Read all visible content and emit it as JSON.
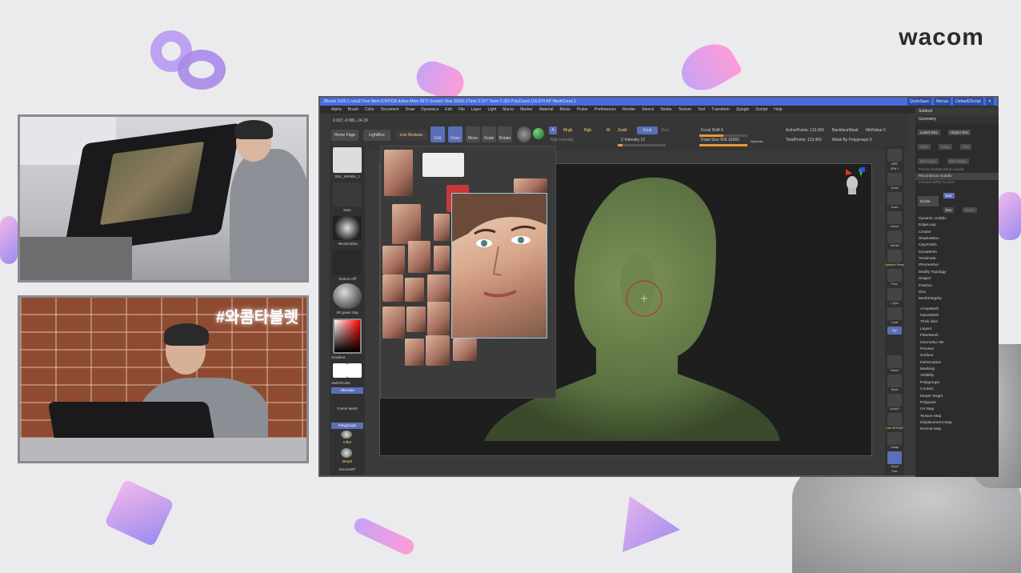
{
  "brand": {
    "logo": "wacom"
  },
  "camera": {
    "neon_sign": "#와콤타블렛"
  },
  "zbrush": {
    "titlebar": "ZBrush 2020.1   cara2   Free Mem 8.947GB  Active Mem 2872  Scratch Disk 20690  ZTime 2.037  Timer 0.301  PolyCount 116.074 KP  MeshCount 1",
    "titlebar_right": [
      "QuickSave",
      "Menus",
      "DefaultZScript"
    ],
    "menus": [
      "Alpha",
      "Brush",
      "Color",
      "Document",
      "Draw",
      "Dynamics",
      "Edit",
      "File",
      "Layer",
      "Light",
      "Macro",
      "Marker",
      "Material",
      "Movie",
      "Picker",
      "Preferences",
      "Render",
      "Stencil",
      "Stroke",
      "Texture",
      "Tool",
      "Transform",
      "Zplugin",
      "Zscript",
      "Help"
    ],
    "coords": "2.007,-0.081,-14.29",
    "toolbar": {
      "home_page": "Home Page",
      "lightbox": "LightBox",
      "live_boolean": "Live Boolean",
      "edit": "Edit",
      "draw": "Draw",
      "move": "Move",
      "scale": "Scale",
      "rotate": "Rotate",
      "a": "A",
      "mrgb": "Mrgb",
      "rgb": "Rgb",
      "m": "M",
      "zadd": "Zadd",
      "zsub": "Zsub",
      "zcut": "Zcut",
      "rgb_intensity": "Rgb Intensity",
      "z_intensity": "Z Intensity 12",
      "focal_shift": "Focal Shift 0",
      "draw_size": "Draw Size 905.16583",
      "dynamic": "Dynamic",
      "active_points": "ActivePoints: 113,455",
      "total_points": "TotalPoints: 113,455",
      "backface_mask": "BackfaceMask",
      "mask_by_polygroups": "Mask By Polygroups 0",
      "mid_value": "MidValue 0"
    },
    "left_shelf": {
      "brush": "SNL_Wrinkle_1",
      "stroke": "Dots",
      "alpha": "~BrushAlpha",
      "texture": "Texture Off",
      "material": "JR green clay",
      "gradient": "Gradient",
      "switch_color": "SwitchColor",
      "alternate": "Alternate",
      "frame_mesh": "Frame Mesh",
      "polygroups": "Polygroups",
      "inflat": "Inflat",
      "morph": "Morph",
      "sourcemt": "SourceMT"
    },
    "right_shelf": [
      "BPR",
      "SPix 3",
      "Scroll",
      "Zoom",
      "Actual",
      "AAHalf",
      "Dynamic Persp",
      "Floor",
      "L.Sym",
      "Local",
      "Xyz",
      "Frame",
      "Move",
      "ZoomD",
      "Line Fill PolyF",
      "Transp",
      "Ghost",
      "Solo"
    ],
    "subtool": {
      "header": "Subtool",
      "geometry": "Geometry",
      "lower_res": "Lower Res",
      "higher_res": "Higher Res",
      "sdiv": "SDiv",
      "cage": "Cage",
      "rstr": "Rstr",
      "del_lower": "Del Lower",
      "del_higher": "Del Higher",
      "freeze": "Freeze SubDivision Levels",
      "reconstruct": "Reconstruct Subdiv",
      "convert": "Convert BPR To Geo",
      "divide": "Divide",
      "smt": "Smt",
      "suv": "Suv",
      "reuv": "ReUV",
      "items": [
        "Dynamic Subdiv",
        "EdgeLoop",
        "Crease",
        "ShadowBox",
        "ClayPolish",
        "DynaMesh",
        "Tessimate",
        "ZRemesher",
        "Modify Topology",
        "Snaper",
        "Position",
        "Size",
        "MeshIntegrity"
      ],
      "items2": [
        "ArrayMesh",
        "NanoMesh",
        "Thick Skin",
        "Layers",
        "FiberMesh",
        "Geometry HD",
        "Preview",
        "Surface",
        "Deformation",
        "Masking",
        "Visibility",
        "Polygroups",
        "Contact",
        "Morph Target",
        "Polypaint",
        "UV Map",
        "Texture Map",
        "Displacement Map",
        "Normal Map"
      ]
    }
  }
}
